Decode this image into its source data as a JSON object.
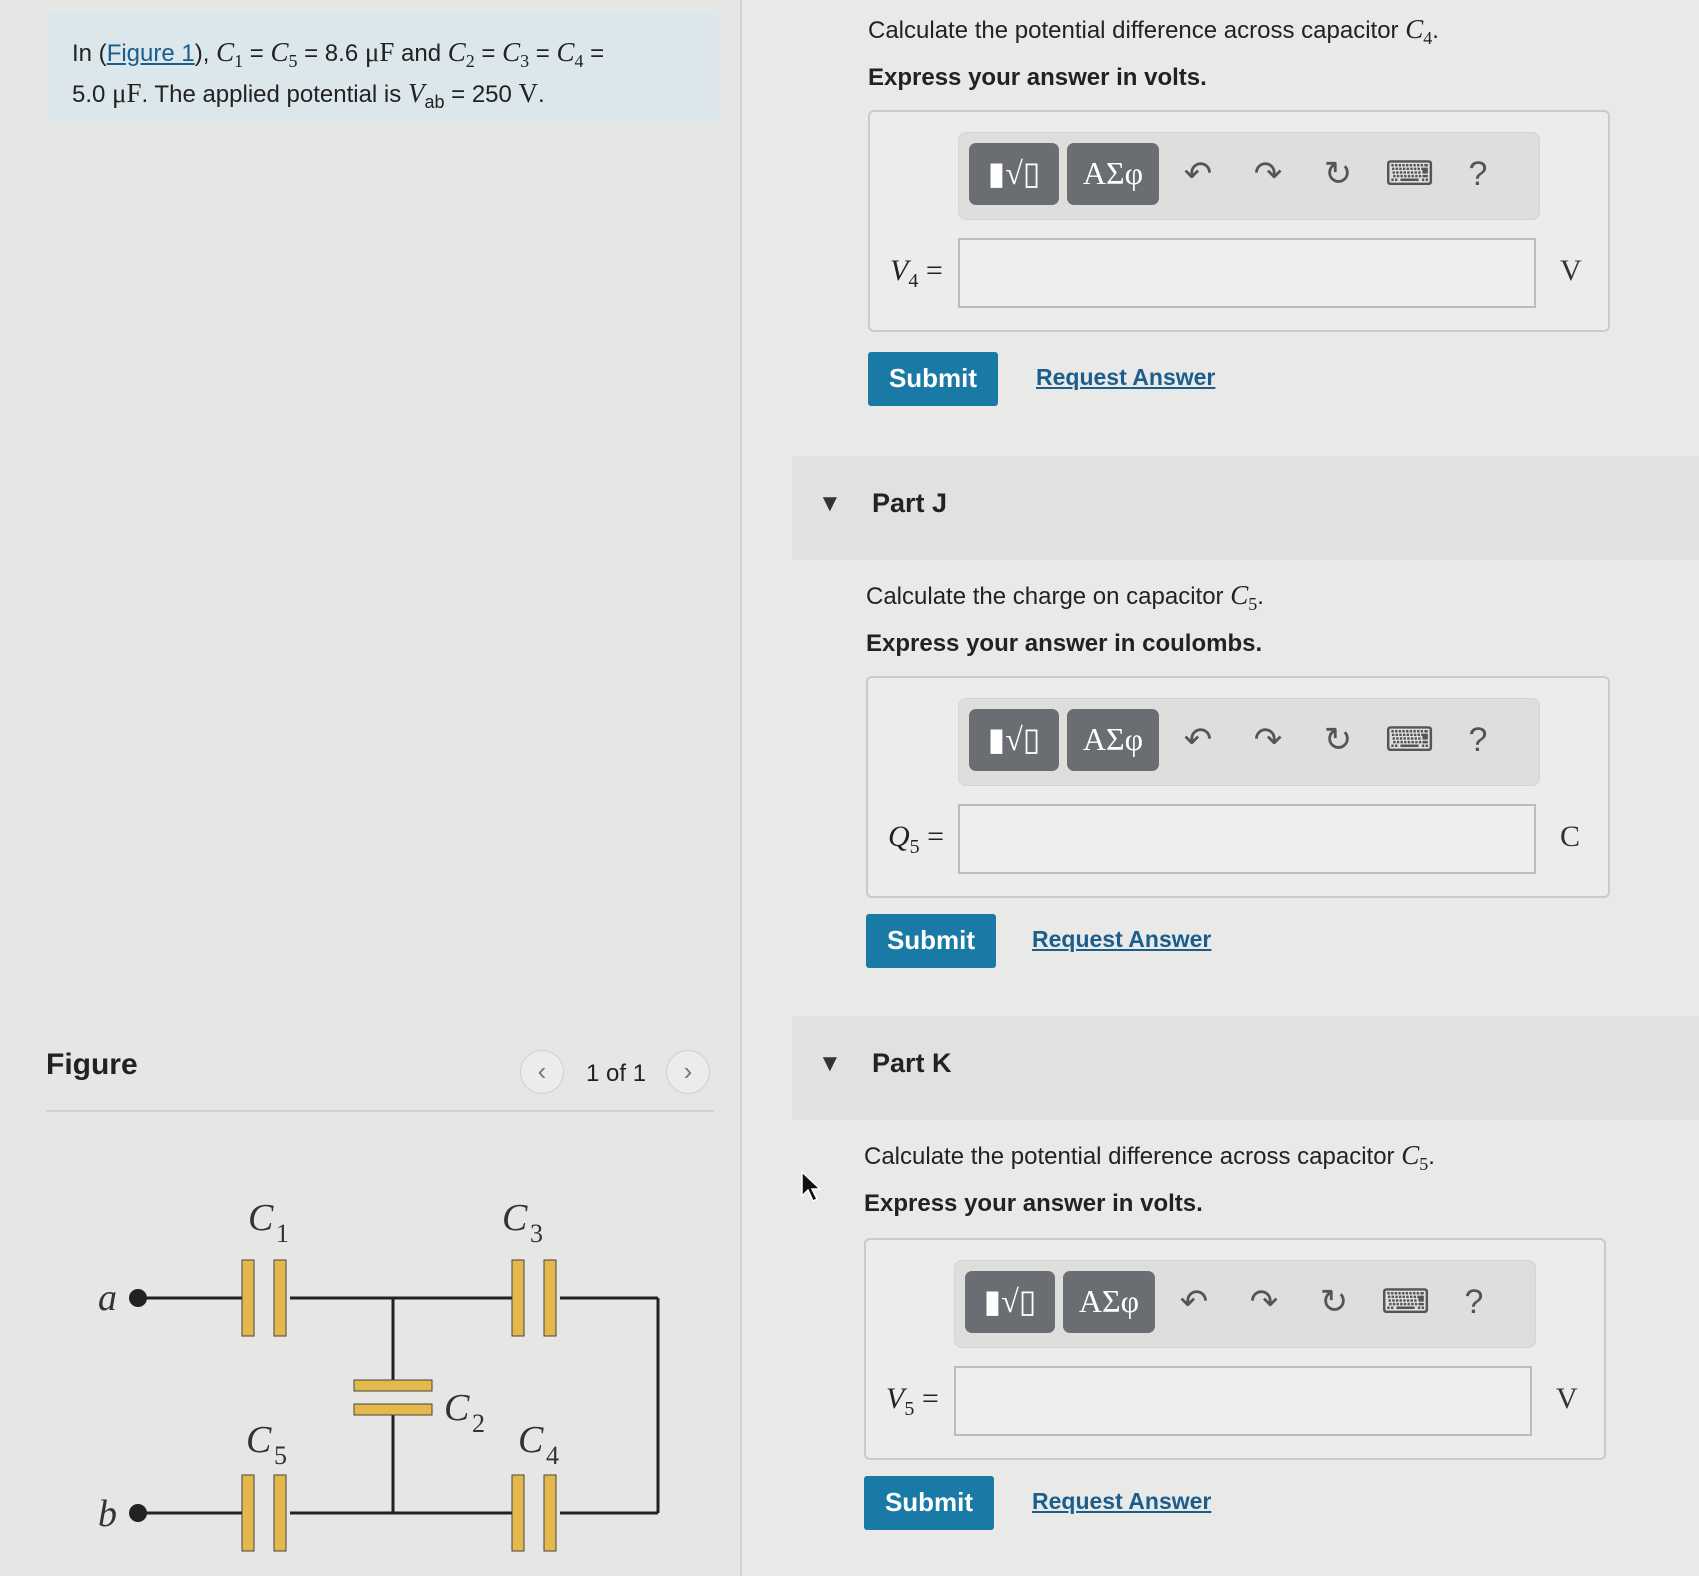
{
  "problem": {
    "prefix": "In (",
    "figure_link": "Figure 1",
    "after_link": "), ",
    "c1": "C",
    "eq1": " = ",
    "c5": "C",
    "val1": " = 8.6 ",
    "unit1": "μF",
    "and_text": " and ",
    "c2": "C",
    "c3": "C",
    "c4": "C",
    "val2": "5.0 ",
    "unit2": "μF",
    "applied": ". The applied potential is ",
    "vab": "V",
    "vab_sub": "ab",
    "vab_val": " = 250 ",
    "vab_unit": "V",
    "period": "."
  },
  "figure": {
    "title": "Figure",
    "pager": "1 of 1",
    "prev": "‹",
    "next": "›",
    "labels": {
      "a": "a",
      "b": "b",
      "c1": "C",
      "c1s": "1",
      "c2": "C",
      "c2s": "2",
      "c3": "C",
      "c3s": "3",
      "c4": "C",
      "c4s": "4",
      "c5": "C",
      "c5s": "5"
    }
  },
  "toolbar": {
    "templates": "▮√▯",
    "greek": "ΑΣφ",
    "undo": "↶",
    "redo": "↷",
    "reset": "↻",
    "keyboard": "⌨",
    "help": "?"
  },
  "part_i": {
    "question": "Calculate the potential difference across capacitor ",
    "cap": "C",
    "cap_sub": "4",
    "instruction": "Express your answer in volts.",
    "var": "V",
    "var_sub": "4",
    "eq": " =",
    "value": "",
    "unit": "V",
    "submit": "Submit",
    "request": "Request Answer"
  },
  "part_j": {
    "title": "Part J",
    "question": "Calculate the charge on capacitor ",
    "cap": "C",
    "cap_sub": "5",
    "instruction": "Express your answer in coulombs.",
    "var": "Q",
    "var_sub": "5",
    "eq": " =",
    "value": "",
    "unit": "C",
    "submit": "Submit",
    "request": "Request Answer"
  },
  "part_k": {
    "title": "Part K",
    "question": "Calculate the potential difference across capacitor ",
    "cap": "C",
    "cap_sub": "5",
    "instruction": "Express your answer in volts.",
    "var": "V",
    "var_sub": "5",
    "eq": " =",
    "value": "",
    "unit": "V",
    "submit": "Submit",
    "request": "Request Answer"
  },
  "colors": {
    "accent": "#1a7aa6",
    "link": "#1b5e8c",
    "capacitor": "#e3b94c",
    "problem_bg": "#dbe7ea"
  }
}
